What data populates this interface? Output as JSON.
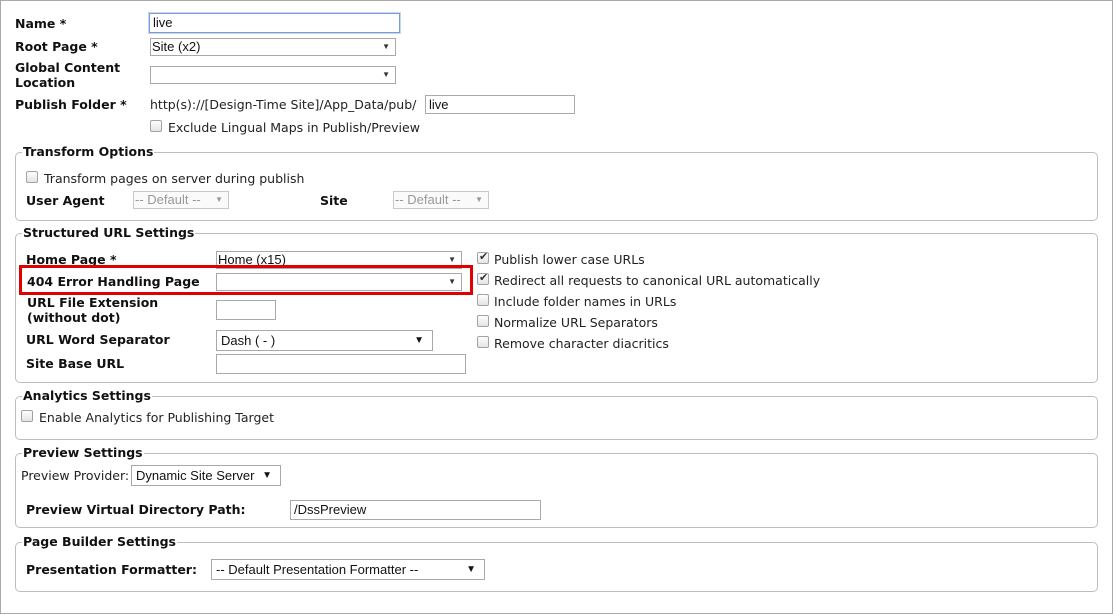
{
  "form": {
    "name_label": "Name *",
    "name_value": "live",
    "root_page_label": "Root Page *",
    "root_page_value": "Site (x2)",
    "global_content_label_line1": "Global Content",
    "global_content_label_line2": "Location",
    "global_content_value": "",
    "publish_folder_label": "Publish Folder *",
    "publish_folder_prefix": "http(s)://[Design-Time Site]/App_Data/pub/",
    "publish_folder_value": "live",
    "exclude_lingual_label": "Exclude Lingual Maps in Publish/Preview",
    "exclude_lingual_checked": false
  },
  "transform": {
    "legend": "Transform Options",
    "transform_pages_label": "Transform pages on server during publish",
    "transform_pages_checked": false,
    "user_agent_label": "User Agent",
    "user_agent_value": "-- Default --",
    "site_label": "Site",
    "site_value": "-- Default --"
  },
  "structured_url": {
    "legend": "Structured URL Settings",
    "home_page_label": "Home Page *",
    "home_page_value": "Home (x15)",
    "error_page_label": "404 Error Handling Page",
    "error_page_value": "",
    "url_ext_label_line1": "URL File Extension",
    "url_ext_label_line2": "(without dot)",
    "url_ext_value": "",
    "word_sep_label": "URL Word Separator",
    "word_sep_value": "Dash ( - )",
    "site_base_label": "Site Base URL",
    "site_base_value": "",
    "options": [
      {
        "label": "Publish lower case URLs",
        "checked": true
      },
      {
        "label": "Redirect all requests to canonical URL automatically",
        "checked": true
      },
      {
        "label": "Include folder names in URLs",
        "checked": false
      },
      {
        "label": "Normalize URL Separators",
        "checked": false
      },
      {
        "label": "Remove character diacritics",
        "checked": false
      }
    ]
  },
  "analytics": {
    "legend": "Analytics Settings",
    "enable_label": "Enable Analytics for Publishing Target",
    "enable_checked": false
  },
  "preview": {
    "legend": "Preview Settings",
    "provider_label": "Preview Provider:",
    "provider_value": "Dynamic Site Server",
    "vdir_label": "Preview Virtual Directory Path:",
    "vdir_value": "/DssPreview"
  },
  "page_builder": {
    "legend": "Page Builder Settings",
    "formatter_label": "Presentation Formatter:",
    "formatter_value": "-- Default Presentation Formatter --"
  },
  "icons": {
    "dropdown": "chevron-down-icon",
    "checkbox_checked": "checkmark-icon"
  },
  "colors": {
    "highlight": "#e00000",
    "focus_border": "#7a9cd3"
  }
}
